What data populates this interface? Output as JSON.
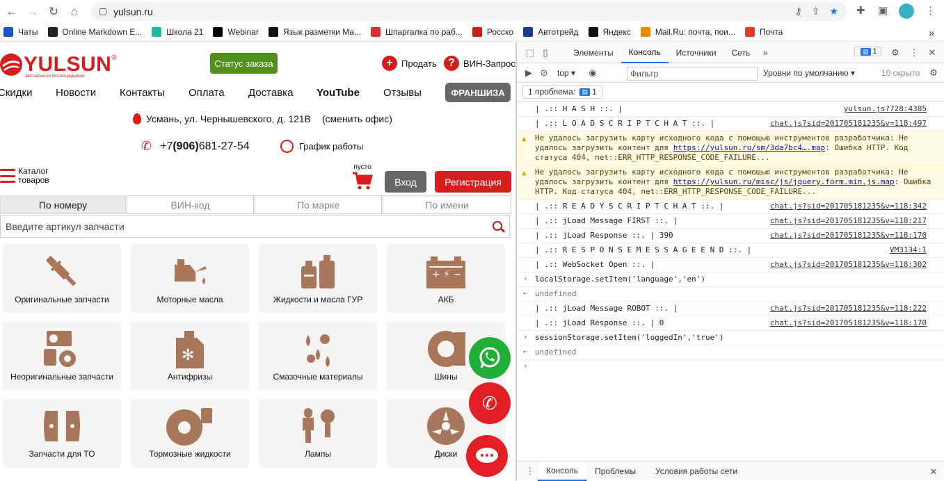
{
  "browser": {
    "url": "yulsun.ru",
    "bookmarks": [
      {
        "label": "Чаты",
        "color": "#1a56c8"
      },
      {
        "label": "Online Markdown E...",
        "color": "#222222"
      },
      {
        "label": "Школа 21",
        "color": "#1fb7a8"
      },
      {
        "label": "Webinar",
        "color": "#000000"
      },
      {
        "label": "Язык разметки Ma...",
        "color": "#111111"
      },
      {
        "label": "Шпаргалка по раб...",
        "color": "#d9302c"
      },
      {
        "label": "Росско",
        "color": "#c81e1e"
      },
      {
        "label": "Автотрейд",
        "color": "#1a3c8c"
      },
      {
        "label": "Яндекс",
        "color": "#111111"
      },
      {
        "label": "Mail.Ru: почта, пои...",
        "color": "#e88a00"
      },
      {
        "label": "Почта",
        "color": "#e33a2b"
      }
    ],
    "more_bookmarks": "»"
  },
  "site": {
    "logo_text": "YULSUN",
    "logo_reg": "®",
    "logo_sub": "автозапчасти без посредников",
    "status_button": "Статус заказа",
    "sell_label": "Продать",
    "vin_label": "ВИН-Запрос",
    "menu": [
      "Скидки",
      "Новости",
      "Контакты",
      "Оплата",
      "Доставка",
      "YouTube",
      "Отзывы"
    ],
    "franchise": "ФРАНШИЗА",
    "address": "Усмань, ул. Чернышевского, д. 121В",
    "change_office": "(сменить офис)",
    "phone_prefix": "+7 ",
    "phone_code": "(906)",
    "phone_number": " 681-27-54",
    "schedule": "График работы",
    "catalog_line1": "Каталог",
    "catalog_line2": "товаров",
    "cart_status": "пусто",
    "login": "Вход",
    "register": "Регистрация",
    "tabs": [
      "По номеру",
      "ВИН-код",
      "По марке",
      "По имени"
    ],
    "search_placeholder": "Введите артикул запчасти",
    "categories": [
      "Оригинальные запчасти",
      "Моторные масла",
      "Жидкости и масла ГУР",
      "АКБ",
      "Неоригинальные запчасти",
      "Антифризы",
      "Смазочные материалы",
      "Шины",
      "Запчасти для ТО",
      "Тормозные жидкости",
      "Лампы",
      "Диски"
    ],
    "accent_color": "#d51f1f",
    "green_color": "#4f8f1a"
  },
  "devtools": {
    "tabs": [
      "Элементы",
      "Консоль",
      "Источники",
      "Сеть"
    ],
    "more_tabs": "»",
    "messages_badge": "1",
    "context": "top",
    "filter_placeholder": "Фильтр",
    "levels": "Уровни по умолчанию",
    "hidden": "10 скрыто",
    "issues_label": "1 проблема:",
    "issues_count": "1",
    "console_rows": [
      {
        "kind": "log",
        "text": "| .:: H A S H ::. |",
        "src": "yulsun.js?728:4385"
      },
      {
        "kind": "log",
        "text": "| .:: L O A D  S C R I P T  C H A T ::. |",
        "src": "chat.js?sid=201705181235&v=118:497"
      },
      {
        "kind": "warn",
        "pre": "Не удалось загрузить карту исходного кода с помощью инструментов разработчика: Не удалось загрузить контент для ",
        "link": "https://yulsun.ru/sm/3da7bc4….map",
        "post": ": Ошибка HTTP. Код статуса 404, net::ERR_HTTP_RESPONSE_CODE_FAILURE..."
      },
      {
        "kind": "warn",
        "pre": "Не удалось загрузить карту исходного кода с помощью инструментов разработчика: Не удалось загрузить контент для ",
        "link": "https://yulsun.ru/misc/js/jquery.form.min.js.map",
        "post": ": Ошибка HTTP. Код статуса 404, net::ERR_HTTP_RESPONSE_CODE_FAILURE..."
      },
      {
        "kind": "log",
        "text": "| .:: R E A D Y  S C R I P T  C H A T ::. |",
        "src": "chat.js?sid=201705181235&v=118:342"
      },
      {
        "kind": "log",
        "text": "| .:: jLoad Message FIRST ::. |",
        "src": "chat.js?sid=201705181235&v=118:217"
      },
      {
        "kind": "log",
        "text": "| .:: jLoad Response ::. | 390",
        "src": "chat.js?sid=201705181235&v=118:170"
      },
      {
        "kind": "log",
        "text": "| .:: R E S P O N S E  M E S S A G E  E N D ::. |",
        "src": "VM3134:1"
      },
      {
        "kind": "log",
        "text": "| .:: WebSocket Open ::. |",
        "src": "chat.js?sid=201705181235&v=118:302"
      },
      {
        "kind": "input",
        "text": "localStorage.setItem('language','en')"
      },
      {
        "kind": "ret",
        "text": "undefined"
      },
      {
        "kind": "log",
        "text": "| .:: jLoad Message ROBOT ::. |",
        "src": "chat.js?sid=201705181235&v=118:222"
      },
      {
        "kind": "log",
        "text": "| .:: jLoad Response ::. | 0",
        "src": "chat.js?sid=201705181235&v=118:170"
      },
      {
        "kind": "input",
        "text": "sessionStorage.setItem('loggedIn','true')"
      },
      {
        "kind": "ret",
        "text": "undefined"
      },
      {
        "kind": "prompt",
        "text": ""
      }
    ],
    "bottom_tabs": [
      "Консоль",
      "Проблемы",
      "Условия работы сети"
    ]
  }
}
